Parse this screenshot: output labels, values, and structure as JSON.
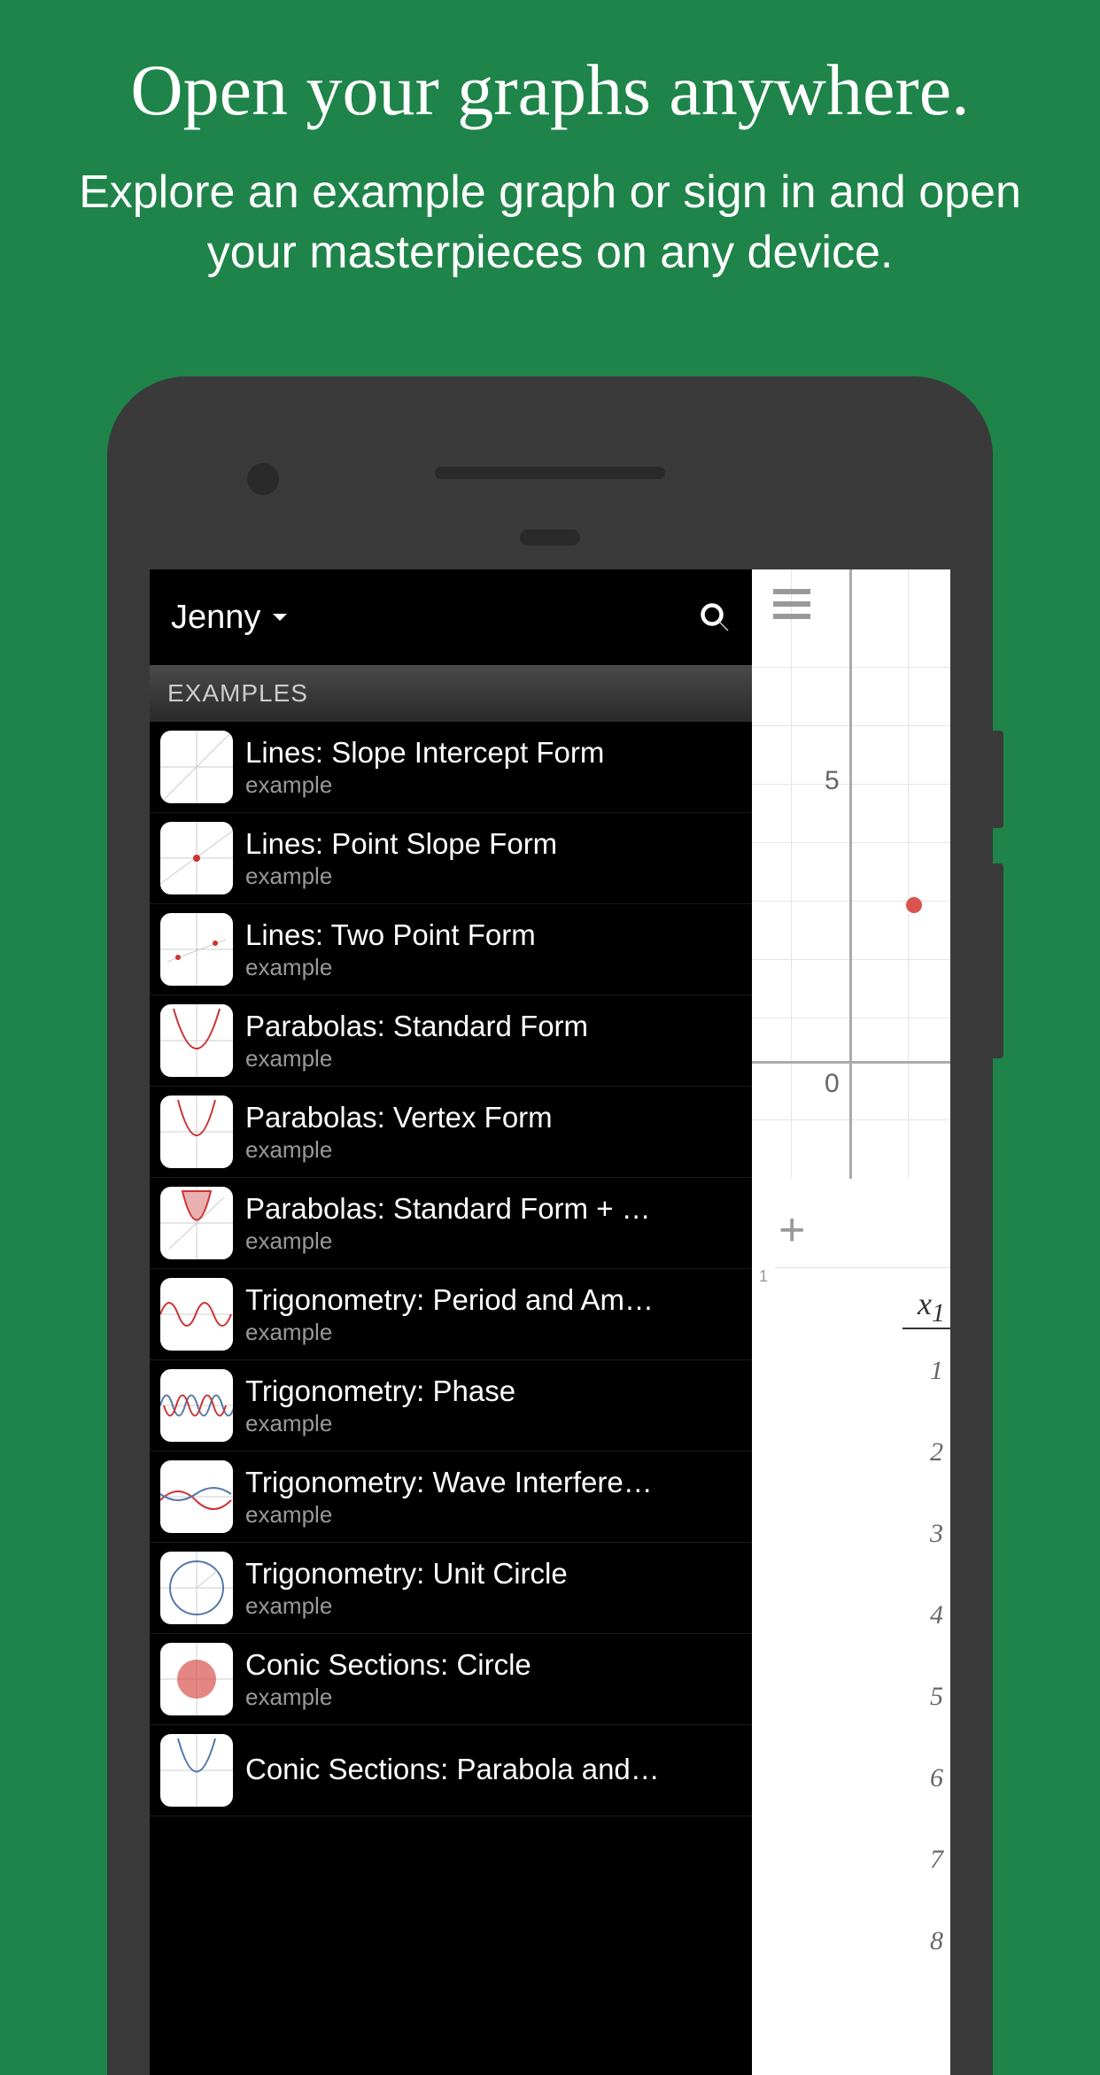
{
  "header": {
    "title": "Open your graphs anywhere.",
    "subtitle": "Explore an example graph or sign in and open your masterpieces on any device."
  },
  "sidebar": {
    "user_name": "Jenny",
    "section_label": "EXAMPLES"
  },
  "examples": [
    {
      "title": "Lines: Slope Intercept Form",
      "subtitle": "example"
    },
    {
      "title": "Lines: Point Slope Form",
      "subtitle": "example"
    },
    {
      "title": "Lines: Two Point Form",
      "subtitle": "example"
    },
    {
      "title": "Parabolas: Standard Form",
      "subtitle": "example"
    },
    {
      "title": "Parabolas: Vertex Form",
      "subtitle": "example"
    },
    {
      "title": "Parabolas: Standard Form + …",
      "subtitle": "example"
    },
    {
      "title": "Trigonometry: Period and Am…",
      "subtitle": "example"
    },
    {
      "title": "Trigonometry: Phase",
      "subtitle": "example"
    },
    {
      "title": "Trigonometry: Wave Interfere…",
      "subtitle": "example"
    },
    {
      "title": "Trigonometry: Unit Circle",
      "subtitle": "example"
    },
    {
      "title": "Conic Sections: Circle",
      "subtitle": "example"
    },
    {
      "title": "Conic Sections: Parabola and…",
      "subtitle": ""
    }
  ],
  "graph": {
    "label_5": "5",
    "label_0": "0",
    "var": "x",
    "row_num": "1",
    "side_numbers": [
      "1",
      "2",
      "3",
      "4",
      "5",
      "6",
      "7",
      "8"
    ]
  }
}
